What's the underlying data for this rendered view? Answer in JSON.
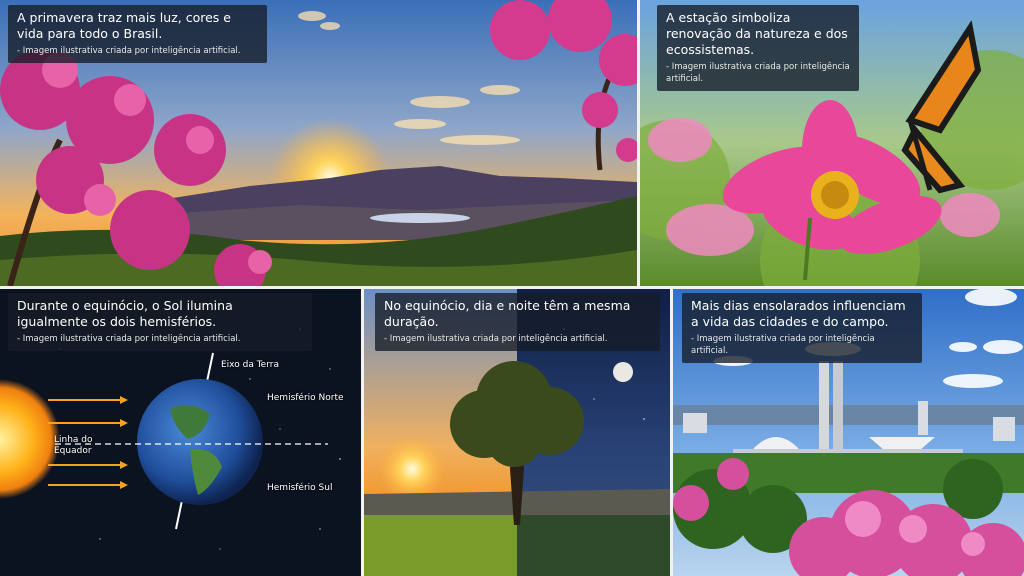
{
  "panels": [
    {
      "title": "A primavera traz mais luz, cores e vida para todo o Brasil.",
      "subtitle": "- Imagem ilustrativa criada por inteligência artificial."
    },
    {
      "title": "A estação simboliza renovação da natureza e dos ecossistemas.",
      "subtitle": "- Imagem ilustrativa criada por inteligência artificial."
    },
    {
      "title": "Durante o equinócio, o Sol ilumina igualmente os dois hemisférios.",
      "subtitle": "- Imagem ilustrativa criada por inteligência artificial.",
      "labels": {
        "axis": "Eixo da Terra",
        "north": "Hemisfério Norte",
        "south": "Hemisfério Sul",
        "equator_line1": "Linha do",
        "equator_line2": "Equador"
      }
    },
    {
      "title": "No equinócio, dia e noite têm a mesma duração.",
      "subtitle": "- Imagem ilustrativa criada por inteligência artificial."
    },
    {
      "title": "Mais dias ensolarados influenciam a vida das cidades e do campo.",
      "subtitle": "- Imagem ilustrativa criada por inteligência artificial."
    }
  ]
}
